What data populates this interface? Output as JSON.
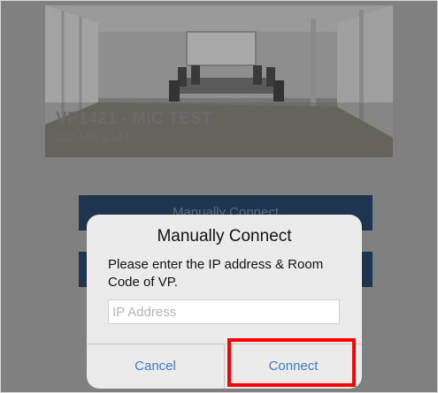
{
  "room": {
    "name": "VP1421 - MIC TEST",
    "ip": "192.168.1.144"
  },
  "background_buttons": {
    "first_label": "Manually Connect",
    "second_label": ""
  },
  "dialog": {
    "title": "Manually Connect",
    "message": "Please enter the IP address & Room Code of VP.",
    "input_value": "",
    "input_placeholder": "IP Address",
    "cancel_label": "Cancel",
    "connect_label": "Connect"
  },
  "colors": {
    "accent": "#3e7ad0",
    "highlight": "#ff0000",
    "button_dark": "#1e3550"
  }
}
